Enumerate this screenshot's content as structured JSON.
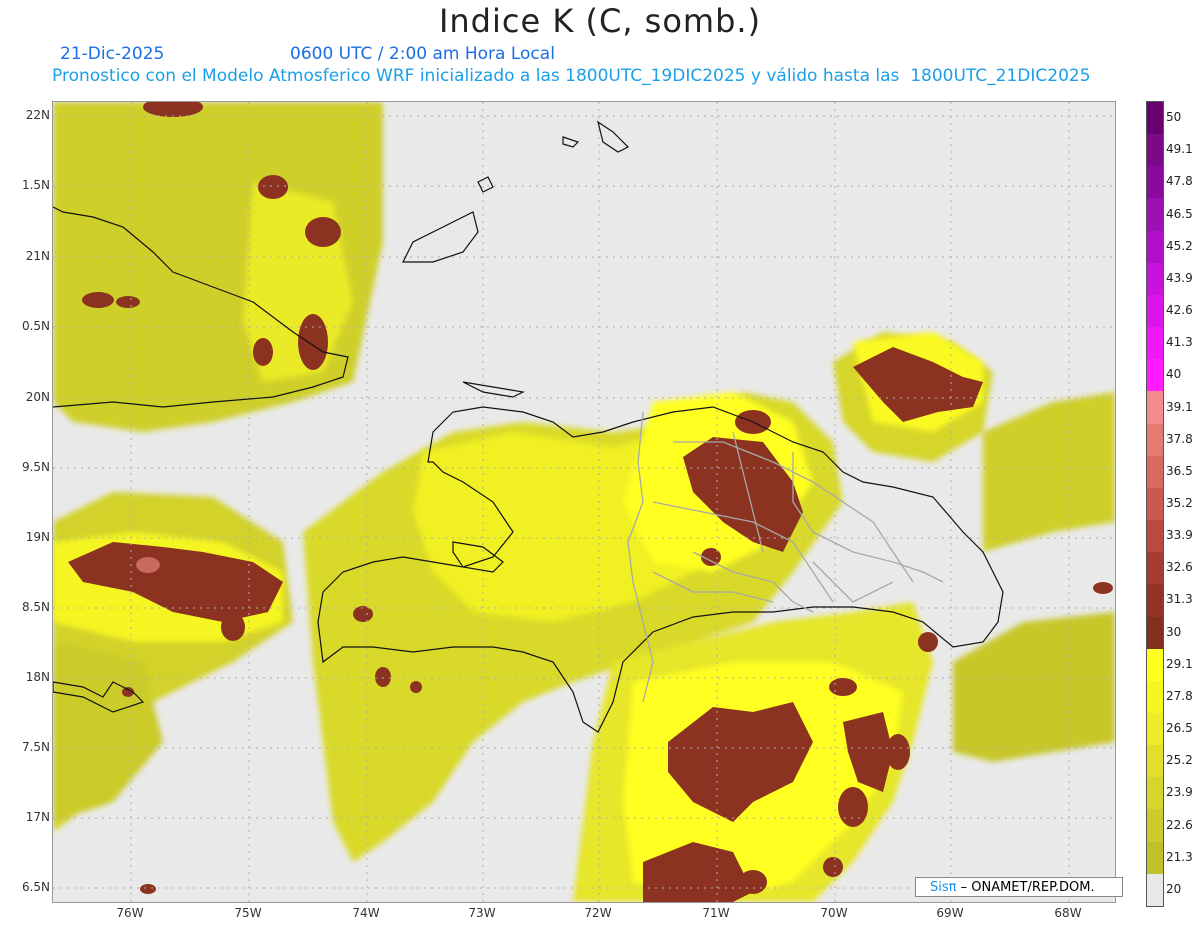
{
  "title": "Indice K (C, somb.)",
  "date_label": "21-Dic-2025",
  "time_label": "0600 UTC / 2:00 am Hora Local",
  "model_label": "Pronostico con el Modelo Atmosferico WRF inicializado a las 1800UTC_19DIC2025 y válido hasta las  1800UTC_21DIC2025",
  "lat_labels": [
    "22N",
    "1.5N",
    "21N",
    "0.5N",
    "20N",
    "9.5N",
    "19N",
    "8.5N",
    "18N",
    "7.5N",
    "17N",
    "6.5N"
  ],
  "lon_labels": [
    "76W",
    "75W",
    "74W",
    "73W",
    "72W",
    "71W",
    "70W",
    "69W",
    "68W"
  ],
  "colorbar": {
    "labels": [
      "50",
      "49.1",
      "47.8",
      "46.5",
      "45.2",
      "43.9",
      "42.6",
      "41.3",
      "40",
      "39.1",
      "37.8",
      "36.5",
      "35.2",
      "33.9",
      "32.6",
      "31.3",
      "30",
      "29.1",
      "27.8",
      "26.5",
      "25.2",
      "23.9",
      "22.6",
      "21.3",
      "20"
    ],
    "colors": [
      "#6a0070",
      "#7a0a85",
      "#8a0a9e",
      "#9d10b4",
      "#b30fc9",
      "#c713db",
      "#dc14ec",
      "#ee18f8",
      "#ff1cff",
      "#f58c8c",
      "#e57a70",
      "#d66a5f",
      "#c85a4f",
      "#b84a40",
      "#a63b32",
      "#953227",
      "#82301e",
      "#ffff20",
      "#f5f524",
      "#ecec28",
      "#e0e02a",
      "#d5d52b",
      "#cbcb2a",
      "#c0c028",
      "#e8e8e8"
    ]
  },
  "credit": {
    "sis": "Sisπ",
    "rest": " – ONAMET/REP.DOM."
  }
}
